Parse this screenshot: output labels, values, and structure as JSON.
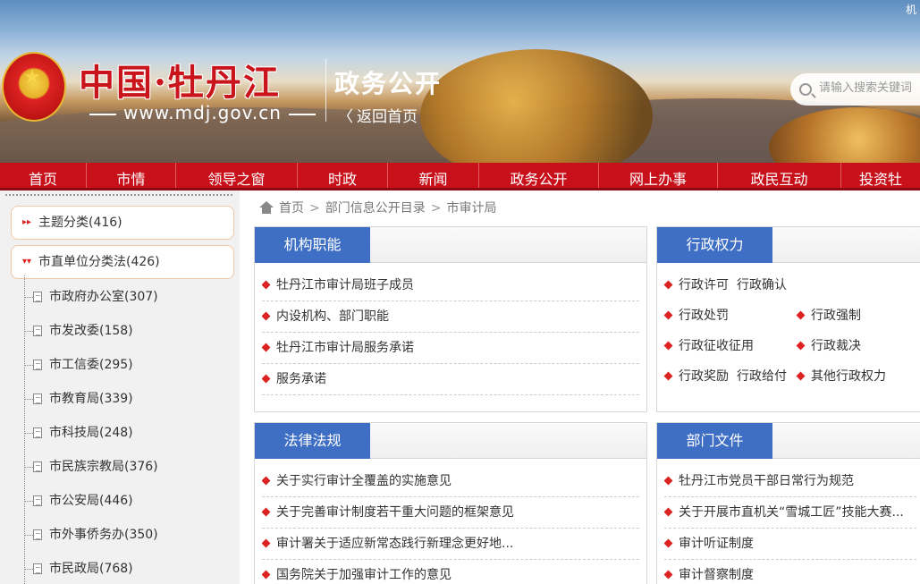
{
  "header": {
    "logo_text": "中国·牡丹江",
    "url": "www.mdj.gov.cn",
    "site_title": "政务公开",
    "back_home": "返回首页",
    "corner_text": "机",
    "search_placeholder": "请输入搜索关键词"
  },
  "nav": {
    "items": [
      "首页",
      "市情",
      "领导之窗",
      "时政",
      "新闻",
      "政务公开",
      "网上办事",
      "政民互动",
      "投资牡"
    ]
  },
  "sidebar": {
    "categories": [
      {
        "label": "主题分类(416)"
      },
      {
        "label": "市直单位分类法(426)"
      }
    ],
    "units": [
      {
        "label": "市政府办公室(307)"
      },
      {
        "label": "市发改委(158)"
      },
      {
        "label": "市工信委(295)"
      },
      {
        "label": "市教育局(339)"
      },
      {
        "label": "市科技局(248)"
      },
      {
        "label": "市民族宗教局(376)"
      },
      {
        "label": "市公安局(446)"
      },
      {
        "label": "市外事侨务办(350)"
      },
      {
        "label": "市民政局(768)"
      }
    ]
  },
  "breadcrumb": {
    "home": "首页",
    "level1": "部门信息公开目录",
    "level2": "市审计局",
    "separator": ">"
  },
  "panels": {
    "org": {
      "title": "机构职能",
      "links": [
        "牡丹江市审计局班子成员",
        "内设机构、部门职能",
        "牡丹江市审计局服务承诺",
        "服务承诺"
      ]
    },
    "power": {
      "title": "行政权力",
      "links": [
        "行政许可",
        "行政确认",
        "行政处罚",
        "行政强制",
        "行政征收征用",
        "行政裁决",
        "行政奖励",
        "行政给付",
        "其他行政权力"
      ]
    },
    "law": {
      "title": "法律法规",
      "links": [
        "关于实行审计全覆盖的实施意见",
        "关于完善审计制度若干重大问题的框架意见",
        "审计署关于适应新常态践行新理念更好地...",
        "国务院关于加强审计工作的意见"
      ]
    },
    "docs": {
      "title": "部门文件",
      "links": [
        "牡丹江市党员干部日常行为规范",
        "关于开展市直机关“雪城工匠”技能大赛...",
        "审计听证制度",
        "审计督察制度"
      ]
    }
  },
  "colors": {
    "nav_red": "#c8101b",
    "tab_blue": "#3e6fc4",
    "bullet_red": "#dd2222"
  }
}
